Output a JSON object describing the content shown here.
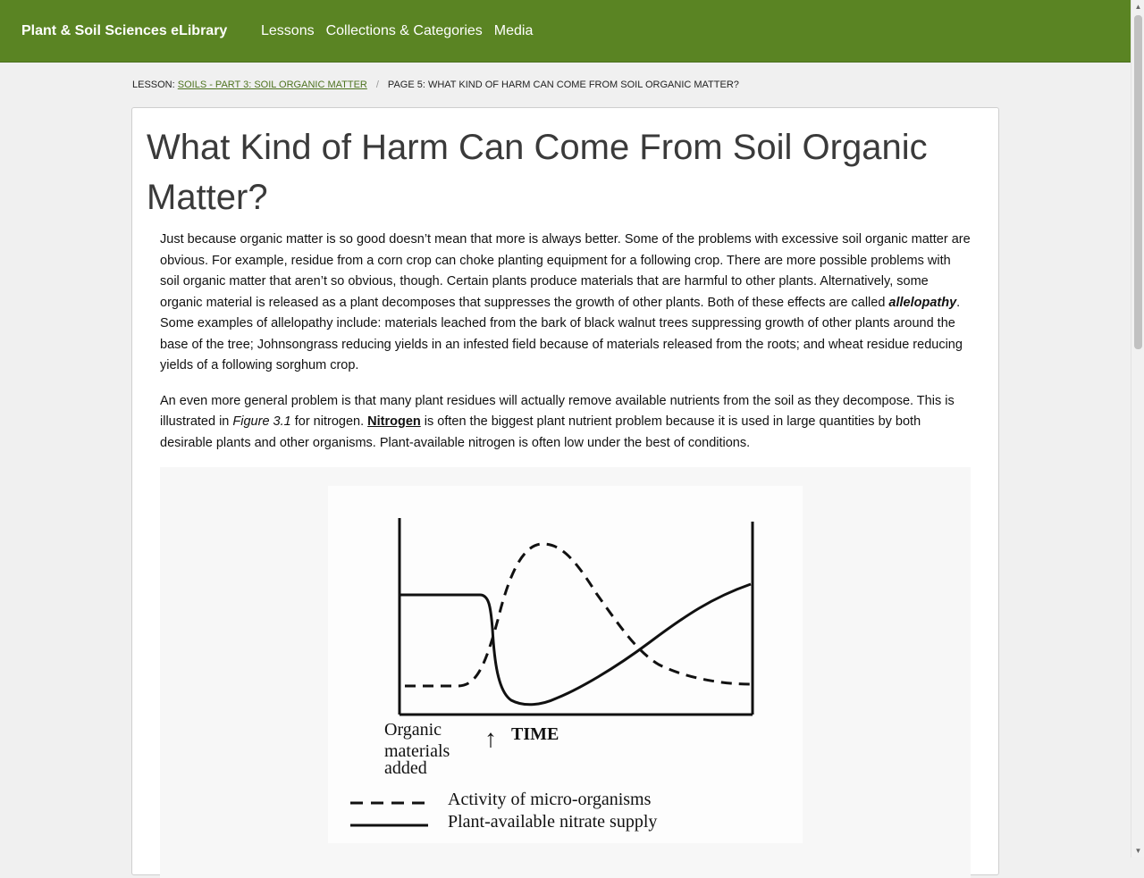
{
  "nav": {
    "brand": "Plant & Soil Sciences eLibrary",
    "links": [
      "Lessons",
      "Collections & Categories",
      "Media"
    ],
    "bg_color": "#5a8423"
  },
  "breadcrumb": {
    "prefix": "Lesson: ",
    "lesson_link": "Soils - Part 3: Soil Organic Matter",
    "separator": "/",
    "current": "Page 5: What Kind of Harm Can Come From Soil Organic Matter?"
  },
  "page": {
    "title": "What Kind of Harm Can Come From Soil Organic Matter?",
    "p1_before": "Just because organic matter is so good doesn’t mean that more is always better. Some of the problems with excessive soil organic matter are obvious. For example, residue from a corn crop can choke planting equipment for a following crop. There are more possible problems with soil organic matter that aren’t so obvious, though. Certain plants produce materials that are harmful to other plants. Alternatively, some organic material is released as a plant decomposes that suppresses the growth of other plants. Both of these effects are called ",
    "p1_term": "allelopathy",
    "p1_after": ". Some examples of allelopathy include: materials leached from the bark of black walnut trees suppressing growth of other plants around the base of the tree; Johnsongrass reducing yields in an infested field because of materials released from the roots; and wheat residue reducing yields of a following sorghum crop.",
    "p2_before": "An even more general problem is that many plant residues will actually remove available nutrients from the soil as they decompose. This is illustrated in ",
    "p2_fig": "Figure 3.1",
    "p2_mid": " for nitrogen. ",
    "p2_link": "Nitrogen",
    "p2_after": " is often the biggest plant nutrient problem because it is used in large quantities by both desirable plants and other organisms. Plant-available nitrogen is often low under the best of conditions."
  },
  "figure": {
    "label_organic_1": "Organic",
    "label_organic_2": "materials",
    "label_organic_3": "added",
    "arrow_glyph": "↑",
    "time_label": "TIME",
    "legend_dashed": "Activity of micro-organisms",
    "legend_solid": "Plant-available nitrate supply"
  },
  "scrollbar": {
    "up_glyph": "▲",
    "down_glyph": "▼"
  }
}
